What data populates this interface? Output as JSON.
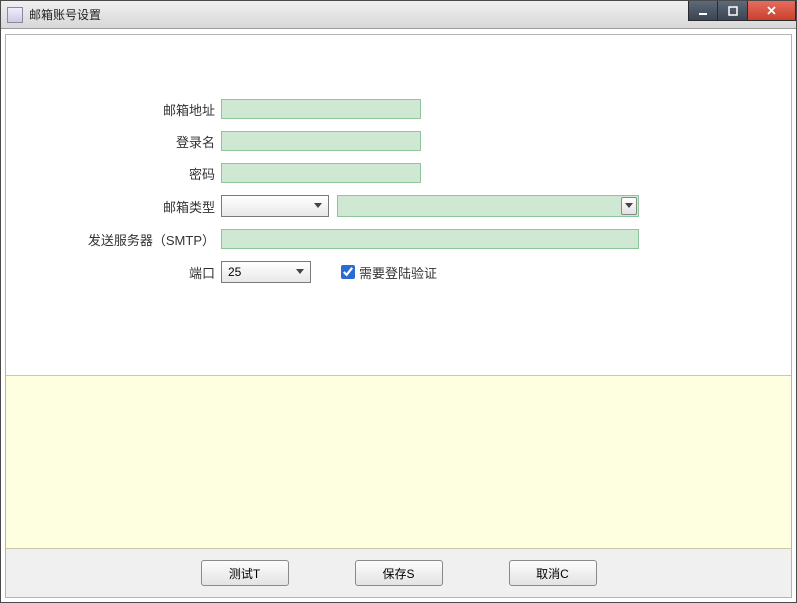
{
  "window": {
    "title": "邮箱账号设置"
  },
  "form": {
    "email_label": "邮箱地址",
    "email_value": "",
    "login_label": "登录名",
    "login_value": "",
    "password_label": "密码",
    "password_value": "",
    "type_label": "邮箱类型",
    "type_value": "",
    "type_detail_value": "",
    "smtp_label": "发送服务器（SMTP）",
    "smtp_value": "",
    "port_label": "端口",
    "port_value": "25",
    "auth_checkbox_label": "需要登陆验证",
    "auth_checked": true
  },
  "buttons": {
    "test": "测试T",
    "save": "保存S",
    "cancel": "取消C"
  }
}
